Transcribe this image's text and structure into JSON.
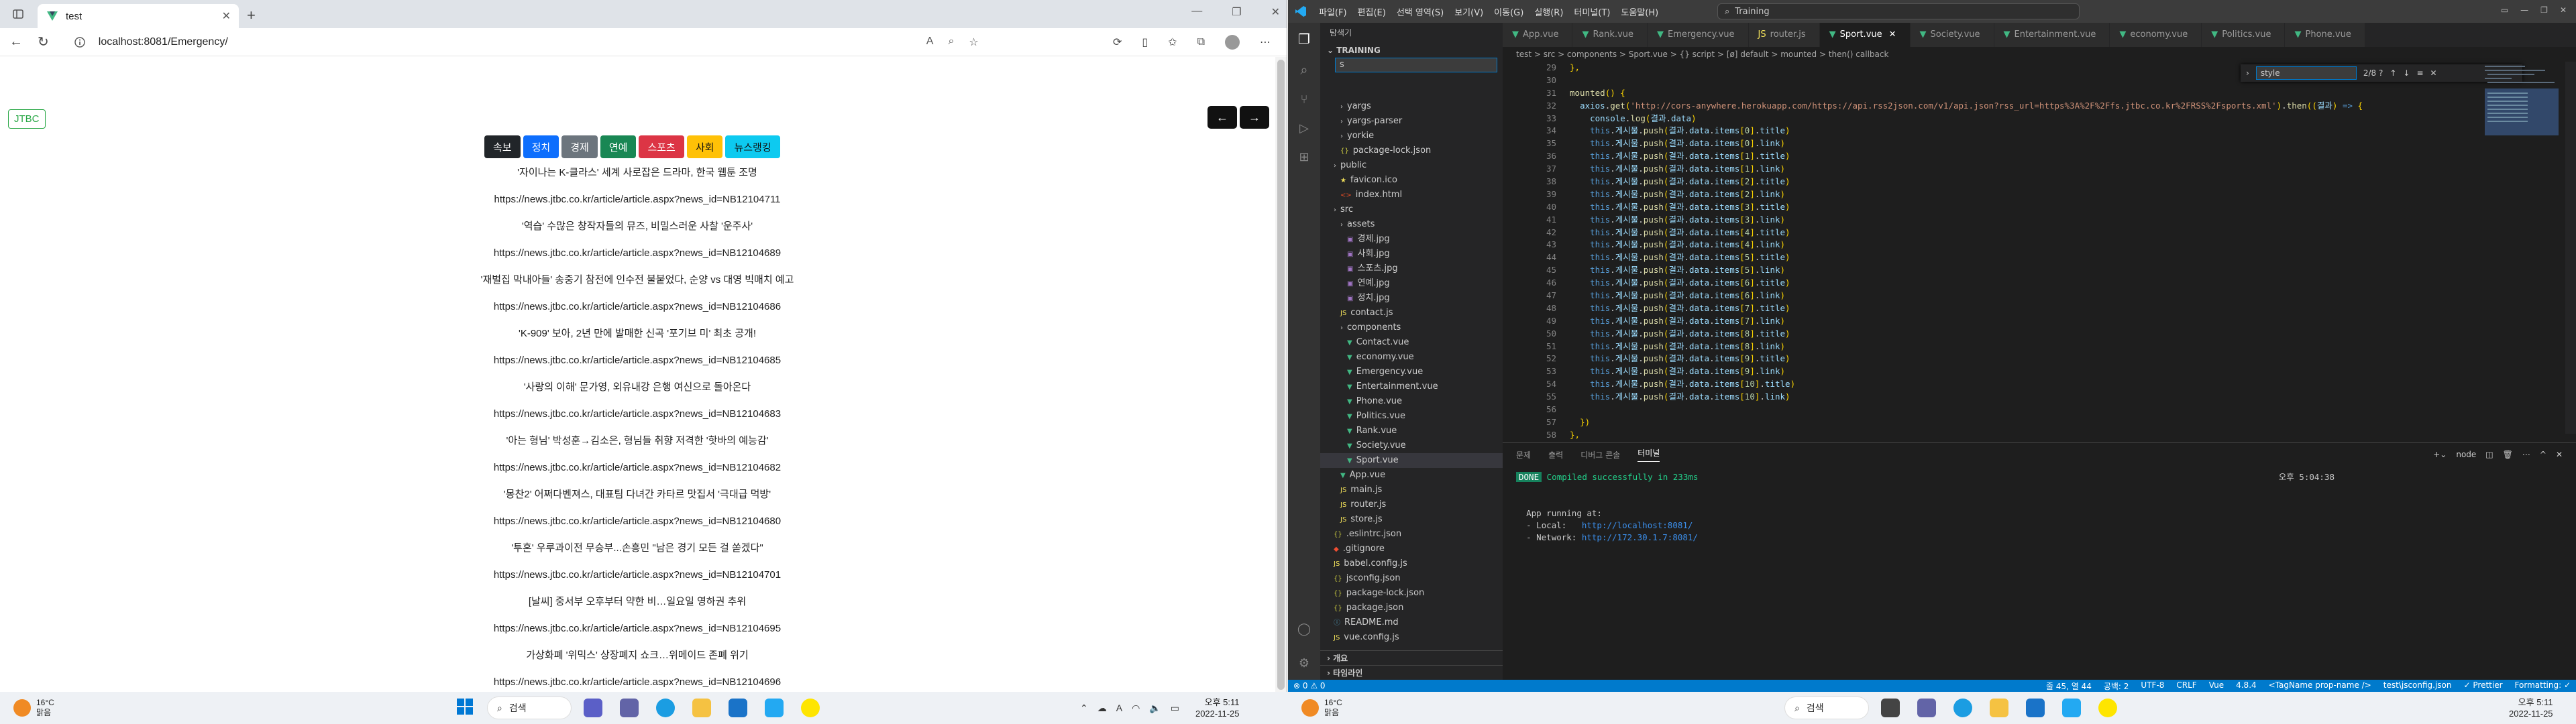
{
  "browser": {
    "tab_title": "test",
    "url": "localhost:8081/Emergency/",
    "brand": "JTBC",
    "prev_arrow": "←",
    "next_arrow": "→",
    "categories": [
      {
        "label": "속보",
        "color": "#212529"
      },
      {
        "label": "정치",
        "color": "#0d6efd"
      },
      {
        "label": "경제",
        "color": "#6c757d"
      },
      {
        "label": "연예",
        "color": "#198754"
      },
      {
        "label": "스포츠",
        "color": "#dc3545"
      },
      {
        "label": "사회",
        "color": "#ffc107"
      },
      {
        "label": "뉴스랭킹",
        "color": "#0dcaf0"
      }
    ],
    "articles": [
      "'자이나는 K-클라스' 세계 사로잡은 드라마, 한국 웹툰 조명",
      "https://news.jtbc.co.kr/article/article.aspx?news_id=NB12104711",
      "'역습' 수많은 창작자들의 뮤즈, 비밀스러운 사찰 '운주사'",
      "https://news.jtbc.co.kr/article/article.aspx?news_id=NB12104689",
      "'재벌집 막내아들' 송중기 참전에 인수전 불붙었다, 순양 vs 대영 빅매치 예고",
      "https://news.jtbc.co.kr/article/article.aspx?news_id=NB12104686",
      "'K-909' 보아, 2년 만에 발매한 신곡 '포기브 미' 최초 공개!",
      "https://news.jtbc.co.kr/article/article.aspx?news_id=NB12104685",
      "'사랑의 이해' 문가영, 외유내강 은행 여신으로 돌아온다",
      "https://news.jtbc.co.kr/article/article.aspx?news_id=NB12104683",
      "'아는 형님' 박성훈→김소은, 형님들 취향 저격한 '핫바의 예능감'",
      "https://news.jtbc.co.kr/article/article.aspx?news_id=NB12104682",
      "'몽찬2' 어쩌다벤져스, 대표팀 다녀간 카타르 맛집서 '극대급 먹방'",
      "https://news.jtbc.co.kr/article/article.aspx?news_id=NB12104680",
      "'투혼' 우루과이전 무승부...손흥민 \"남은 경기 모든 걸 쏟겠다\"",
      "https://news.jtbc.co.kr/article/article.aspx?news_id=NB12104701",
      "[날씨] 중서부 오후부터 약한 비…일요일 영하권 추위",
      "https://news.jtbc.co.kr/article/article.aspx?news_id=NB12104695",
      "가상화폐 '위믹스' 상장폐지 쇼크…위메이드 존폐 위기",
      "https://news.jtbc.co.kr/article/article.aspx?news_id=NB12104696"
    ]
  },
  "vscode": {
    "menus": [
      "파일(F)",
      "편집(E)",
      "선택 영역(S)",
      "보기(V)",
      "이동(G)",
      "실행(R)",
      "터미널(T)",
      "도움말(H)"
    ],
    "command_center": "Training",
    "explorer_title": "탐색기",
    "project": "TRAINING",
    "find_value": "s",
    "tree": [
      {
        "label": "yargs",
        "indent": 2,
        "type": "folder"
      },
      {
        "label": "yargs-parser",
        "indent": 2,
        "type": "folder"
      },
      {
        "label": "yorkie",
        "indent": 2,
        "type": "folder"
      },
      {
        "label": "package-lock.json",
        "indent": 2,
        "type": "json"
      },
      {
        "label": "public",
        "indent": 1,
        "type": "folder"
      },
      {
        "label": "favicon.ico",
        "indent": 2,
        "type": "ico"
      },
      {
        "label": "index.html",
        "indent": 2,
        "type": "html"
      },
      {
        "label": "src",
        "indent": 1,
        "type": "folder"
      },
      {
        "label": "assets",
        "indent": 2,
        "type": "folder"
      },
      {
        "label": "경제.jpg",
        "indent": 3,
        "type": "img"
      },
      {
        "label": "사회.jpg",
        "indent": 3,
        "type": "img"
      },
      {
        "label": "스포츠.jpg",
        "indent": 3,
        "type": "img"
      },
      {
        "label": "연예.jpg",
        "indent": 3,
        "type": "img"
      },
      {
        "label": "정치.jpg",
        "indent": 3,
        "type": "img"
      },
      {
        "label": "contact.js",
        "indent": 2,
        "type": "js"
      },
      {
        "label": "components",
        "indent": 2,
        "type": "folder"
      },
      {
        "label": "Contact.vue",
        "indent": 3,
        "type": "vue"
      },
      {
        "label": "economy.vue",
        "indent": 3,
        "type": "vue"
      },
      {
        "label": "Emergency.vue",
        "indent": 3,
        "type": "vue"
      },
      {
        "label": "Entertainment.vue",
        "indent": 3,
        "type": "vue"
      },
      {
        "label": "Phone.vue",
        "indent": 3,
        "type": "vue"
      },
      {
        "label": "Politics.vue",
        "indent": 3,
        "type": "vue"
      },
      {
        "label": "Rank.vue",
        "indent": 3,
        "type": "vue"
      },
      {
        "label": "Society.vue",
        "indent": 3,
        "type": "vue"
      },
      {
        "label": "Sport.vue",
        "indent": 3,
        "type": "vue"
      },
      {
        "label": "App.vue",
        "indent": 2,
        "type": "vue"
      },
      {
        "label": "main.js",
        "indent": 2,
        "type": "js"
      },
      {
        "label": "router.js",
        "indent": 2,
        "type": "js"
      },
      {
        "label": "store.js",
        "indent": 2,
        "type": "js"
      },
      {
        "label": ".eslintrc.json",
        "indent": 1,
        "type": "json"
      },
      {
        "label": ".gitignore",
        "indent": 1,
        "type": "git"
      },
      {
        "label": "babel.config.js",
        "indent": 1,
        "type": "js"
      },
      {
        "label": "jsconfig.json",
        "indent": 1,
        "type": "json"
      },
      {
        "label": "package-lock.json",
        "indent": 1,
        "type": "json"
      },
      {
        "label": "package.json",
        "indent": 1,
        "type": "json"
      },
      {
        "label": "README.md",
        "indent": 1,
        "type": "md"
      },
      {
        "label": "vue.config.js",
        "indent": 1,
        "type": "js"
      }
    ],
    "sidebar_footer": [
      "개요",
      "타임라인"
    ],
    "tabs": [
      "App.vue",
      "Rank.vue",
      "Emergency.vue",
      "router.js",
      "Sport.vue",
      "Society.vue",
      "Entertainment.vue",
      "economy.vue",
      "Politics.vue",
      "Phone.vue"
    ],
    "active_tab": "Sport.vue",
    "breadcrumbs": "test > src > components > Sport.vue > {} script > [ø] default > mounted > then() callback",
    "find_widget": {
      "value": "style",
      "result": "2/8 ?"
    },
    "line_start": 29,
    "axios_url": "http://cors-anywhere.herokuapp.com/https://api.rss2json.com/v1/api.json?rss_url=https%3A%2F%2Ffs.jtbc.co.kr%2FRSS%2Fsports.xml",
    "panel_tabs": [
      "문제",
      "출력",
      "디버그 콘솔",
      "터미널"
    ],
    "active_panel": "터미널",
    "terminal_node": "node",
    "terminal": {
      "done_badge": "DONE",
      "compiled": "Compiled successfully in 233ms",
      "time": "오후 5:04:38",
      "running": "App running at:",
      "local_label": "- Local:   ",
      "local_url": "http://localhost:8081/",
      "network_label": "- Network: ",
      "network_url": "http://172.30.1.7:8081/"
    },
    "status_left": [
      "⊗ 0 ⚠ 0"
    ],
    "status_right": [
      "줄 45, 열 44",
      "공백: 2",
      "UTF-8",
      "CRLF",
      "Vue",
      "4.8.4",
      "<TagName prop-name />",
      "test\\jsconfig.json",
      "✓ Prettier",
      "Formatting: ✓"
    ]
  },
  "taskbar_left": {
    "temp": "16°C",
    "weather": "맑음",
    "search": "검색",
    "time": "오후 5:11",
    "date": "2022-11-25"
  },
  "taskbar_right": {
    "temp": "16°C",
    "weather": "맑음",
    "search": "검색",
    "time": "오후 5:11",
    "date": "2022-11-25"
  }
}
